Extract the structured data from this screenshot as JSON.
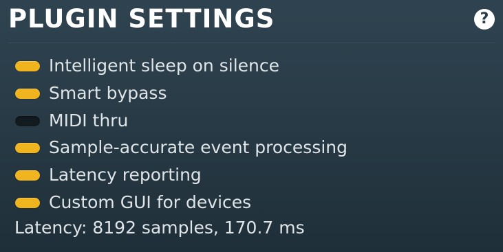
{
  "panel": {
    "title": "PLUGIN SETTINGS",
    "help_icon": "?"
  },
  "options": [
    {
      "label": "Intelligent sleep on silence",
      "enabled": true
    },
    {
      "label": "Smart bypass",
      "enabled": true
    },
    {
      "label": "MIDI thru",
      "enabled": false
    },
    {
      "label": "Sample-accurate event processing",
      "enabled": true
    },
    {
      "label": "Latency reporting",
      "enabled": true
    },
    {
      "label": "Custom GUI for devices",
      "enabled": true
    }
  ],
  "latency_text": "Latency: 8192 samples, 170.7 ms",
  "colors": {
    "toggle_on": "#f0b51e",
    "toggle_off": "#111b20",
    "background": "#2a3d49",
    "text": "#dfe4e7"
  }
}
